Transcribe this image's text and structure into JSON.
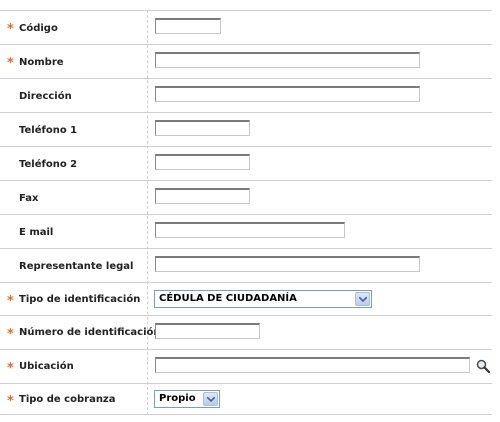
{
  "form": {
    "fields": [
      {
        "key": "codigo",
        "label": "Código",
        "required": true,
        "value": ""
      },
      {
        "key": "nombre",
        "label": "Nombre",
        "required": true,
        "value": ""
      },
      {
        "key": "direccion",
        "label": "Dirección",
        "required": false,
        "value": ""
      },
      {
        "key": "telefono1",
        "label": "Teléfono 1",
        "required": false,
        "value": ""
      },
      {
        "key": "telefono2",
        "label": "Teléfono 2",
        "required": false,
        "value": ""
      },
      {
        "key": "fax",
        "label": "Fax",
        "required": false,
        "value": ""
      },
      {
        "key": "email",
        "label": "E mail",
        "required": false,
        "value": ""
      },
      {
        "key": "representante",
        "label": "Representante legal",
        "required": false,
        "value": ""
      },
      {
        "key": "tipo_identificacion",
        "label": "Tipo de identificación",
        "required": true,
        "selected": "CÉDULA DE CIUDADANÍA"
      },
      {
        "key": "numero_identificacion",
        "label": "Número de identificación",
        "required": true,
        "value": ""
      },
      {
        "key": "ubicacion",
        "label": "Ubicación",
        "required": true,
        "value": ""
      },
      {
        "key": "tipo_cobranza",
        "label": "Tipo de cobranza",
        "required": true,
        "selected": "Propio"
      }
    ],
    "required_marker": "*",
    "colors": {
      "required": "#e26b2a",
      "row_border": "#cfcfcf",
      "select_border": "#7f9db9"
    }
  }
}
